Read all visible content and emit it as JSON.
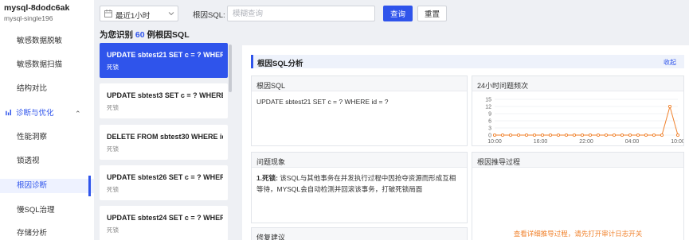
{
  "sidebar": {
    "instance_name": "mysql-8dodc6ak",
    "instance_sub": "mysql-single196",
    "items": [
      {
        "label": "敏感数据脱敏"
      },
      {
        "label": "敏感数据扫描"
      },
      {
        "label": "结构对比"
      },
      {
        "label": "诊断与优化"
      },
      {
        "label": "性能洞察"
      },
      {
        "label": "锁透视"
      },
      {
        "label": "根因诊断"
      },
      {
        "label": "慢SQL治理"
      },
      {
        "label": "存储分析"
      }
    ],
    "active_item": "根因诊断"
  },
  "toolbar": {
    "time_range": "最近1小时",
    "sql_label": "根因SQL:",
    "sql_placeholder": "模糊查询",
    "query_button": "查询",
    "reset_button": "重置"
  },
  "summary": {
    "prefix": "为您识别",
    "count": "60",
    "suffix": "例根因SQL"
  },
  "sql_list": [
    {
      "sql": "UPDATE sbtest21 SET c = ? WHERE id = ?",
      "type": "死锁",
      "active": true
    },
    {
      "sql": "UPDATE sbtest3 SET c = ? WHERE id = ?",
      "type": "死锁"
    },
    {
      "sql": "DELETE FROM sbtest30 WHERE id = ?",
      "type": "死锁"
    },
    {
      "sql": "UPDATE sbtest26 SET c = ? WHERE id = ?",
      "type": "死锁"
    },
    {
      "sql": "UPDATE sbtest24 SET c = ? WHERE id = ?",
      "type": "死锁"
    }
  ],
  "analysis": {
    "title": "根因SQL分析",
    "collapse": "收起",
    "root_sql_title": "根因SQL",
    "root_sql": "UPDATE sbtest21 SET c = ? WHERE id = ?",
    "freq_title": "24小时问题频次",
    "phenomenon_title": "问题现象",
    "phenomenon_label": "1.死锁:",
    "phenomenon_text": "该SQL与其他事务在并发执行过程中因抢夺资源而形成互相等待，MYSQL会自动检测并回滚该事务，打破死锁局面",
    "derivation_title": "根因推导过程",
    "derivation_hint": "查看详细推导过程，请先打开审计日志开关",
    "suggestion_title": "修复建议"
  },
  "chart_data": {
    "type": "line",
    "title": "24小时问题频次",
    "y_ticks": [
      0,
      3,
      6,
      9,
      12,
      15
    ],
    "ylim": [
      0,
      15
    ],
    "x_ticks": [
      "10:00",
      "16:00",
      "22:00",
      "04:00",
      "10:00"
    ],
    "values": [
      0,
      0,
      0,
      0,
      0,
      0,
      0,
      0,
      0,
      0,
      0,
      0,
      0,
      0,
      0,
      0,
      0,
      0,
      0,
      0,
      0,
      0,
      12,
      0
    ],
    "color": "#f0812b",
    "grid": true
  },
  "colors": {
    "accent": "#2f54eb",
    "warning": "#f0812b"
  }
}
